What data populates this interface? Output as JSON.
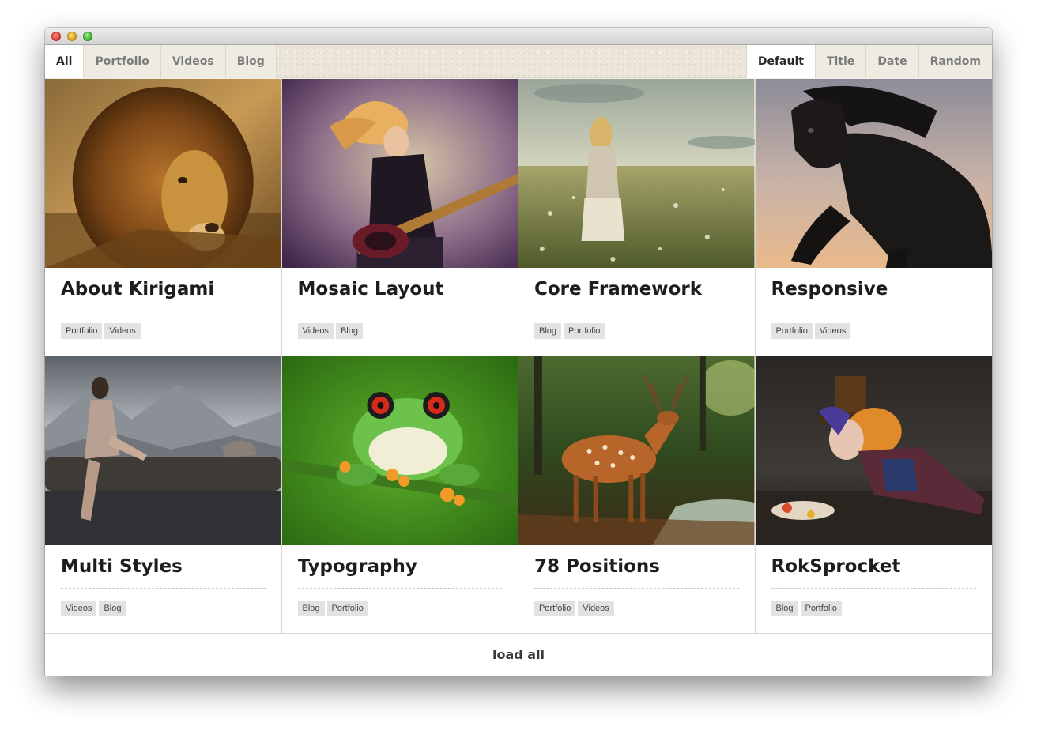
{
  "filter_tabs": [
    {
      "label": "All",
      "active": true
    },
    {
      "label": "Portfolio",
      "active": false
    },
    {
      "label": "Videos",
      "active": false
    },
    {
      "label": "Blog",
      "active": false
    }
  ],
  "sort_tabs": [
    {
      "label": "Default",
      "active": true
    },
    {
      "label": "Title",
      "active": false
    },
    {
      "label": "Date",
      "active": false
    },
    {
      "label": "Random",
      "active": false
    }
  ],
  "cards": [
    {
      "title": "About Kirigami",
      "image": "lion-photo",
      "tags": [
        "Portfolio",
        "Videos"
      ]
    },
    {
      "title": "Mosaic Layout",
      "image": "guitarist-photo",
      "tags": [
        "Videos",
        "Blog"
      ]
    },
    {
      "title": "Core Framework",
      "image": "woman-in-field-photo",
      "tags": [
        "Blog",
        "Portfolio"
      ]
    },
    {
      "title": "Responsive",
      "image": "black-horse-photo",
      "tags": [
        "Portfolio",
        "Videos"
      ]
    },
    {
      "title": "Multi Styles",
      "image": "woman-on-log-photo",
      "tags": [
        "Videos",
        "Blog"
      ]
    },
    {
      "title": "Typography",
      "image": "tree-frog-photo",
      "tags": [
        "Blog",
        "Portfolio"
      ]
    },
    {
      "title": "78 Positions",
      "image": "deer-in-forest-photo",
      "tags": [
        "Portfolio",
        "Videos"
      ]
    },
    {
      "title": "RokSprocket",
      "image": "mad-hatter-photo",
      "tags": [
        "Blog",
        "Portfolio"
      ]
    }
  ],
  "load_all_label": "load all",
  "colors": {
    "active_tab_bg": "#ffffff",
    "inactive_tab_text": "#7b7b7b",
    "tag_bg": "#e2e2e2",
    "toolbar_bg": "#ebe6d9"
  }
}
